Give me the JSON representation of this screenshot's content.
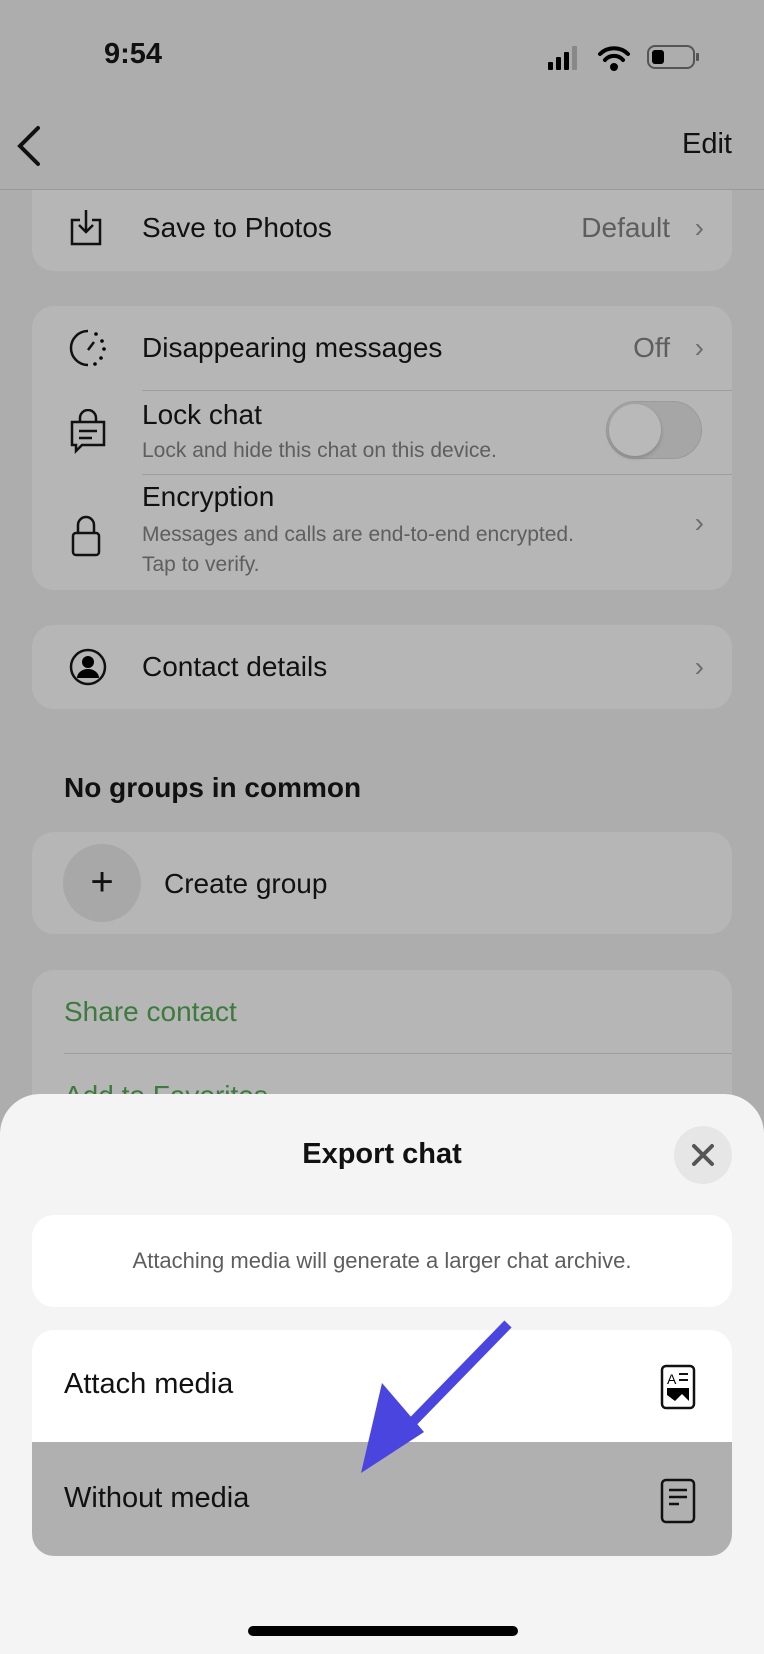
{
  "status": {
    "time": "9:54"
  },
  "nav": {
    "edit_label": "Edit"
  },
  "settings": {
    "save_to_photos": {
      "label": "Save to Photos",
      "value": "Default"
    },
    "disappearing": {
      "label": "Disappearing messages",
      "value": "Off"
    },
    "lock_chat": {
      "label": "Lock chat",
      "subtitle": "Lock and hide this chat on this device.",
      "enabled": false
    },
    "encryption": {
      "label": "Encryption",
      "subtitle1": "Messages and calls are end-to-end encrypted.",
      "subtitle2": "Tap to verify."
    },
    "contact_details": {
      "label": "Contact details"
    }
  },
  "groups": {
    "heading": "No groups in common",
    "create_label": "Create group"
  },
  "actions": {
    "share_contact": "Share contact",
    "add_favorites": "Add to Favorites"
  },
  "sheet": {
    "title": "Export chat",
    "info": "Attaching media will generate a larger chat archive.",
    "options": [
      {
        "label": "Attach media",
        "icon": "media-document-icon"
      },
      {
        "label": "Without media",
        "icon": "document-icon"
      }
    ]
  },
  "colors": {
    "accent_green": "#3d7a3d",
    "annotation_arrow": "#4b45e0"
  }
}
